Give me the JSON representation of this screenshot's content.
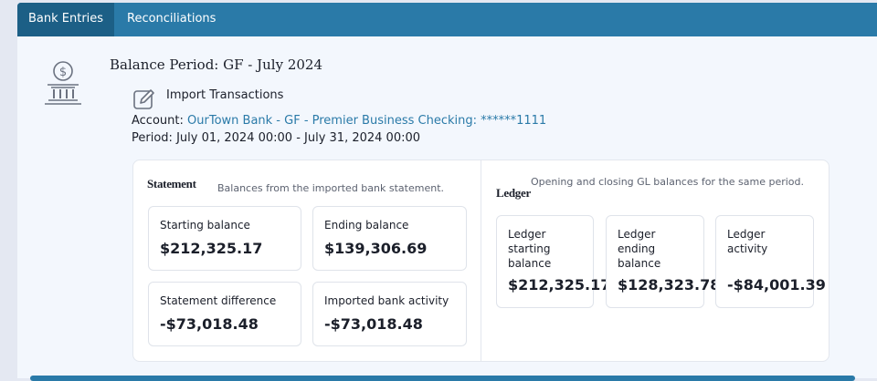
{
  "tabs": [
    {
      "label": "Bank Entries",
      "active": true
    },
    {
      "label": "Reconciliations",
      "active": false
    }
  ],
  "header": {
    "title": "Balance Period: GF - July 2024",
    "icon": "bank-dollar-icon"
  },
  "import": {
    "label": "Import Transactions",
    "icon": "edit-icon"
  },
  "account": {
    "label": "Account:",
    "value": "OurTown Bank - GF - Premier Business Checking: ******1111"
  },
  "period": {
    "label": "Period:",
    "value": "July 01, 2024 00:00 - July 31, 2024 00:00"
  },
  "statement": {
    "title": "Statement",
    "description": "Balances from the imported bank statement.",
    "cards": [
      {
        "label": "Starting balance",
        "value": "$212,325.17"
      },
      {
        "label": "Ending balance",
        "value": "$139,306.69"
      },
      {
        "label": "Statement difference",
        "value": "-$73,018.48"
      },
      {
        "label": "Imported bank activity",
        "value": "-$73,018.48"
      }
    ]
  },
  "ledger": {
    "title": "Ledger",
    "description": "Opening and closing GL balances for the same period.",
    "cards": [
      {
        "label": "Ledger starting balance",
        "value": "$212,325.17"
      },
      {
        "label": "Ledger ending balance",
        "value": "$128,323.78"
      },
      {
        "label": "Ledger activity",
        "value": "-$84,001.39"
      }
    ]
  },
  "colors": {
    "accent": "#2a7aa8",
    "tab_active": "#1c5f86",
    "panel_bg": "#f3f7fd"
  }
}
